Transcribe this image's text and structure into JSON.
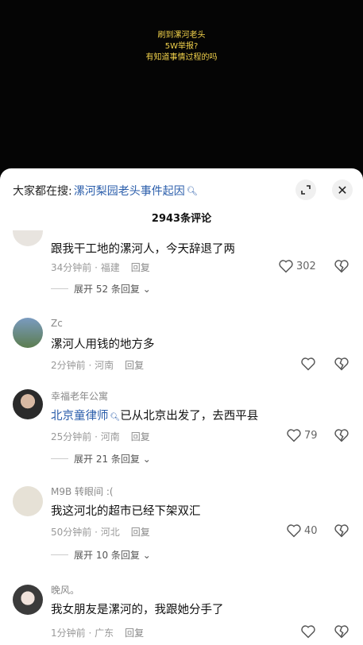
{
  "video": {
    "overlay_lines": [
      "刷到漯河老头",
      "5W举报?",
      "有知道事情过程的吗"
    ]
  },
  "sheet": {
    "search_prefix": "大家都在搜:",
    "search_link": "漯河梨园老头事件起因",
    "comment_count": "2943条评论"
  },
  "comments": [
    {
      "user": "",
      "text": "跟我干工地的漯河人，今天辞退了两",
      "time": "34分钟前 · 福建",
      "reply": "回复",
      "likes": "302",
      "expand": "展开 52 条回复"
    },
    {
      "user": "Zc",
      "text": "漯河人用钱的地方多",
      "time": "2分钟前 · 河南",
      "reply": "回复",
      "likes": "",
      "expand": ""
    },
    {
      "user": "幸福老年公寓",
      "mention": "北京童律师",
      "text": "已从北京出发了，去西平县",
      "time": "25分钟前 · 河南",
      "reply": "回复",
      "likes": "79",
      "expand": "展开 21 条回复"
    },
    {
      "user": "M9B 转眼间 :(",
      "text": "我这河北的超市已经下架双汇",
      "time": "50分钟前 · 河北",
      "reply": "回复",
      "likes": "40",
      "expand": "展开 10 条回复"
    },
    {
      "user": "晚风。",
      "text": "我女朋友是漯河的，我跟她分手了",
      "time": "1分钟前 · 广东",
      "reply": "回复",
      "likes": "",
      "expand": ""
    }
  ],
  "colors": {
    "link": "#2b5eab",
    "overlay_text": "#f2d24b"
  },
  "icons": [
    "search-icon",
    "expand-icon",
    "close-icon",
    "heart-icon",
    "dislike-icon",
    "chevron-down-icon"
  ]
}
